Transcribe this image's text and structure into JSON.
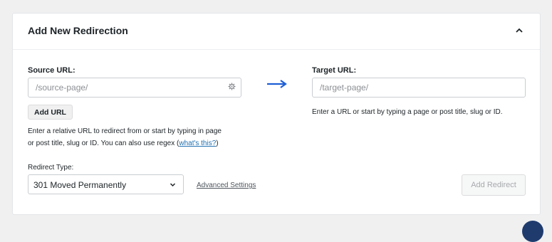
{
  "panel": {
    "title": "Add New Redirection"
  },
  "source": {
    "label": "Source URL:",
    "placeholder": "/source-page/",
    "value": "",
    "add_url_label": "Add URL",
    "help_line1": "Enter a relative URL to redirect from or start by typing in page",
    "help_line2_prefix": "or post title, slug or ID. You can also use regex (",
    "help_link": "what's this?",
    "help_line2_suffix": ")"
  },
  "target": {
    "label": "Target URL:",
    "placeholder": "/target-page/",
    "value": "",
    "help": "Enter a URL or start by typing a page or post title, slug or ID."
  },
  "redirect_type": {
    "label": "Redirect Type:",
    "selected": "301 Moved Permanently"
  },
  "advanced_settings_label": "Advanced Settings",
  "add_redirect_label": "Add Redirect",
  "icons": {
    "collapse": "chevron-up-icon",
    "source_field": "gear-icon",
    "direction": "arrow-right-icon",
    "select": "chevron-down-icon"
  },
  "colors": {
    "arrow": "#1e5fd6",
    "link": "#2271b1",
    "disabled_text": "#a7aaad"
  }
}
